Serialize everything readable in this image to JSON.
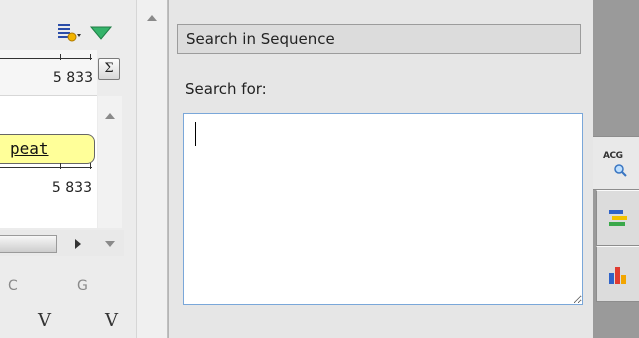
{
  "sequence_view": {
    "ruler_top_value": "5 833",
    "sum_button_label": "Σ",
    "feature_label": "peat",
    "ruler_bottom_value": "5 833",
    "nucleotide_labels": [
      "C",
      "G"
    ],
    "variant_marks": [
      "V",
      "V"
    ]
  },
  "search_panel": {
    "header_title": "Search in Sequence",
    "search_for_label": "Search for:",
    "search_value": ""
  },
  "right_toolbar": {
    "active_tab_label": "ACG"
  },
  "colors": {
    "feature_fill": "#ffff99",
    "input_border": "#7aa7d9",
    "toolbar_strip": "#9a9a9a",
    "triangle_green": "#35b36a"
  }
}
